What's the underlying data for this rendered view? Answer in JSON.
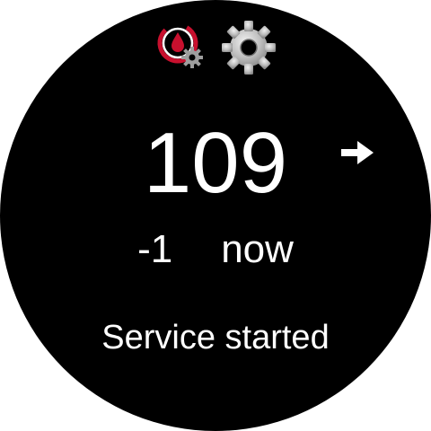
{
  "header": {
    "app_icon": "blood-drop-gear-icon",
    "settings_icon": "gear-icon"
  },
  "reading": {
    "value": "109",
    "trend_icon": "arrow-right-icon",
    "delta": "-1",
    "time": "now"
  },
  "status": {
    "text": "Service started"
  },
  "colors": {
    "background": "#000000",
    "text": "#ffffff",
    "accent_red": "#c8102e",
    "icon_gray": "#bdbdbd"
  }
}
